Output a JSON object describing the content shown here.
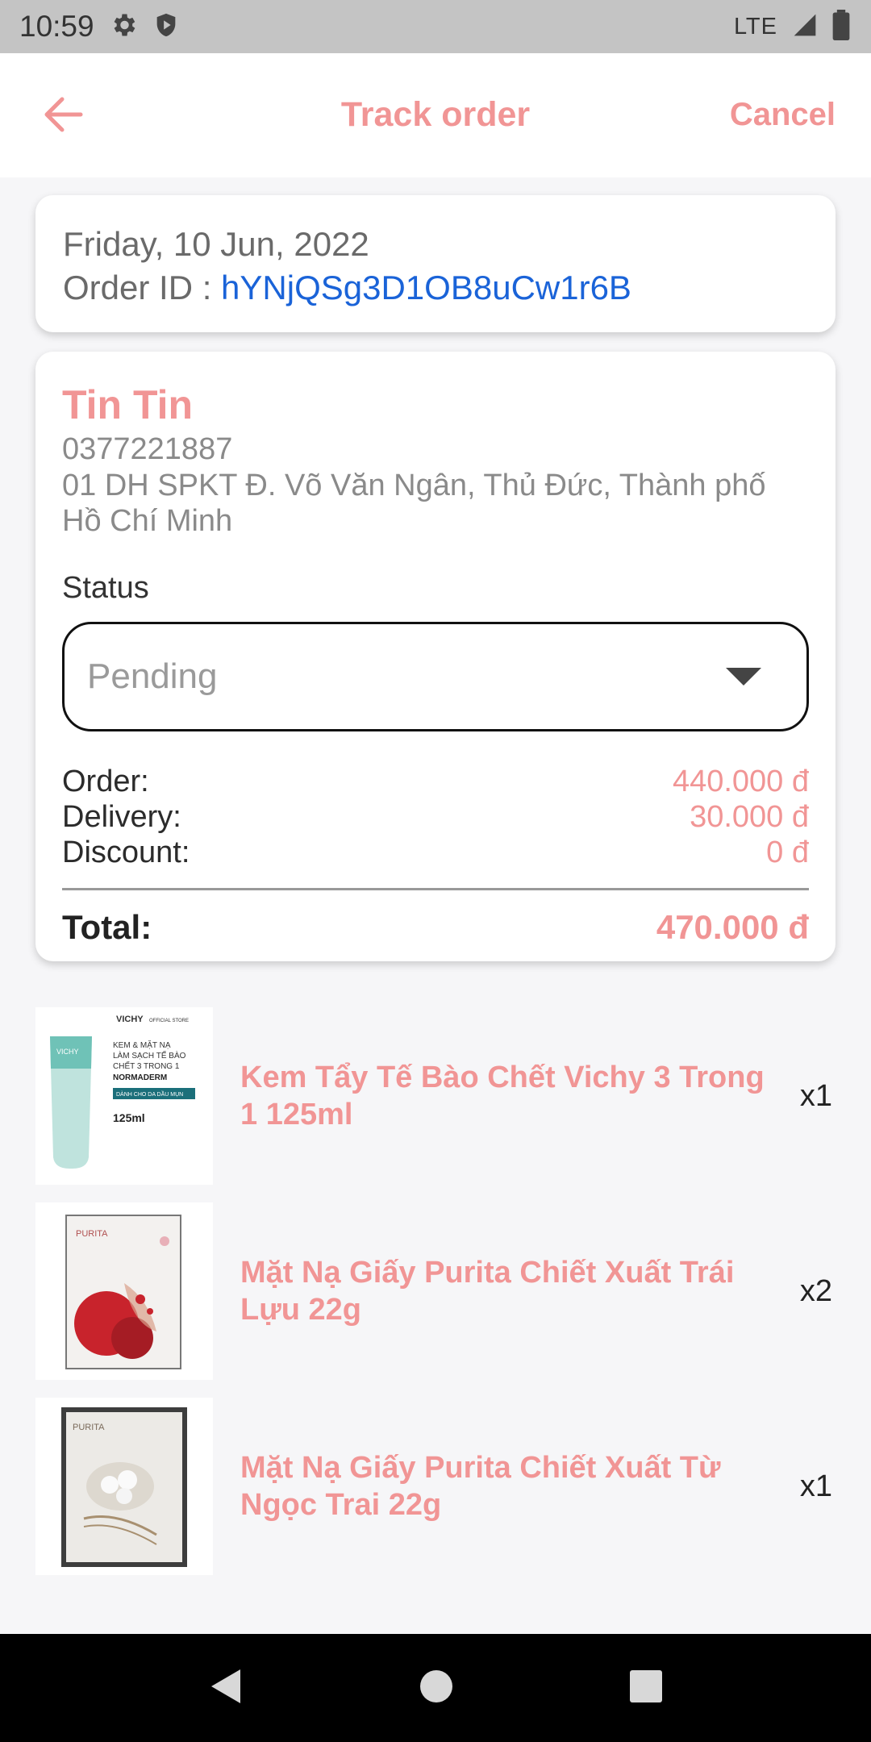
{
  "status_bar": {
    "time": "10:59",
    "network": "LTE",
    "icons": [
      "gear-icon",
      "shield-icon",
      "signal-icon",
      "battery-icon"
    ]
  },
  "app_bar": {
    "title": "Track order",
    "cancel_label": "Cancel",
    "back_icon": "arrow-left-icon"
  },
  "order": {
    "date": "Friday, 10 Jun, 2022",
    "id_label": "Order ID : ",
    "id_value": "hYNjQSg3D1OB8uCw1r6B"
  },
  "customer": {
    "name": "Tin Tin",
    "phone": "0377221887",
    "address": "01 DH SPKT Đ. Võ Văn Ngân, Thủ Đức, Thành phố Hồ Chí Minh"
  },
  "status": {
    "label": "Status",
    "selected": "Pending"
  },
  "summary": {
    "order_label": "Order:",
    "order_value": "440.000 đ",
    "delivery_label": "Delivery:",
    "delivery_value": "30.000 đ",
    "discount_label": "Discount:",
    "discount_value": "0 đ",
    "total_label": "Total:",
    "total_value": "470.000 đ"
  },
  "items": [
    {
      "name": "Kem Tẩy Tế Bào Chết Vichy 3 Trong 1 125ml",
      "qty": "x1",
      "thumb": {
        "brand": "VICHY",
        "store": "OFFICIAL STORE",
        "line1": "KEM & MẶT NẠ",
        "line2": "LÀM SẠCH TẾ BÀO",
        "line3": "CHẾT 3 TRONG 1",
        "product": "NORMADERM",
        "band": "DÀNH CHO DA DẦU MỤN",
        "size": "125ml"
      }
    },
    {
      "name": "Mặt Nạ Giấy Purita Chiết Xuất Trái Lựu 22g",
      "qty": "x2",
      "thumb": {
        "brand": "PURITA"
      }
    },
    {
      "name": "Mặt Nạ Giấy Purita Chiết Xuất Từ Ngọc Trai 22g",
      "qty": "x1",
      "thumb": {
        "brand": "PURITA"
      }
    }
  ],
  "colors": {
    "accent": "#f19595",
    "link": "#1a63d8",
    "text_muted": "#8a8a8a"
  },
  "nav": {
    "icons": [
      "back-triangle-icon",
      "home-circle-icon",
      "recents-square-icon"
    ]
  }
}
